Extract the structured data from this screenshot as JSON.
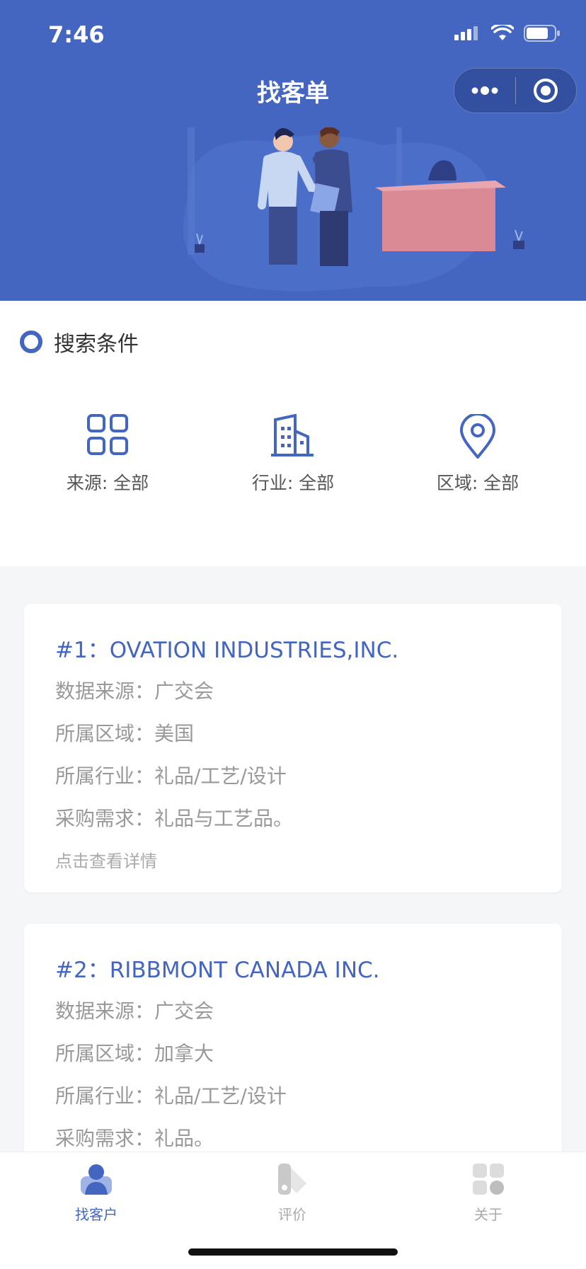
{
  "status_bar": {
    "time": "7:46"
  },
  "header": {
    "title": "找客单",
    "menu_icon": "more-dots-icon",
    "close_icon": "target-circle-icon",
    "accent": "#4466c1"
  },
  "search": {
    "title": "搜索条件",
    "filters": [
      {
        "label": "来源: 全部",
        "icon": "grid-icon"
      },
      {
        "label": "行业: 全部",
        "icon": "building-icon"
      },
      {
        "label": "区域: 全部",
        "icon": "location-pin-icon"
      }
    ]
  },
  "cards": [
    {
      "title": "#1：OVATION INDUSTRIES,INC.",
      "source": "数据来源：广交会",
      "region": "所属区域：美国",
      "industry": "所属行业：礼品/工艺/设计",
      "demand": "采购需求：礼品与工艺品。",
      "link": "点击查看详情"
    },
    {
      "title": "#2：RIBBMONT CANADA INC.",
      "source": "数据来源：广交会",
      "region": "所属区域：加拿大",
      "industry": "所属行业：礼品/工艺/设计",
      "demand": "采购需求：礼品。"
    }
  ],
  "tabbar": {
    "items": [
      {
        "label": "找客户",
        "icon": "person-icon",
        "active": true
      },
      {
        "label": "评价",
        "icon": "review-icon",
        "active": false
      },
      {
        "label": "关于",
        "icon": "apps-icon",
        "active": false
      }
    ]
  }
}
